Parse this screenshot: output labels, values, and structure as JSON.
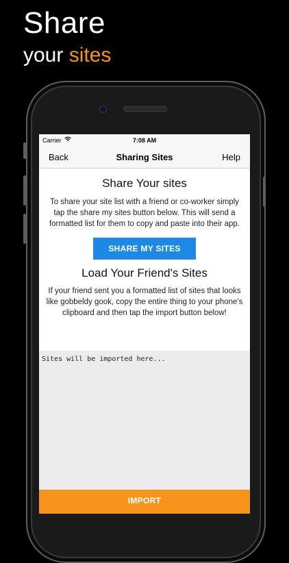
{
  "headline": {
    "line1": "Share",
    "line2_prefix": "your",
    "line2_accent": "sites"
  },
  "colors": {
    "accent": "#f7941d",
    "primary_button": "#1e88e5",
    "background": "#000000"
  },
  "status_bar": {
    "carrier": "Carrier",
    "wifi_icon": "wifi-icon",
    "time": "7:08 AM"
  },
  "nav": {
    "back_label": "Back",
    "title": "Sharing Sites",
    "help_label": "Help"
  },
  "share_section": {
    "heading": "Share Your sites",
    "description": "To share your site list with a friend or co-worker simply tap the share my sites button below.  This will send a formatted list for them to copy and paste into their app.",
    "button_label": "SHARE MY SITES"
  },
  "load_section": {
    "heading": "Load Your Friend's Sites",
    "description": "If your friend sent you a formatted list of sites that looks like gobbeldy gook, copy the entire thing to your phone's clipboard and then tap the import button below!",
    "input_placeholder": "Sites will be imported here...",
    "button_label": "IMPORT"
  }
}
